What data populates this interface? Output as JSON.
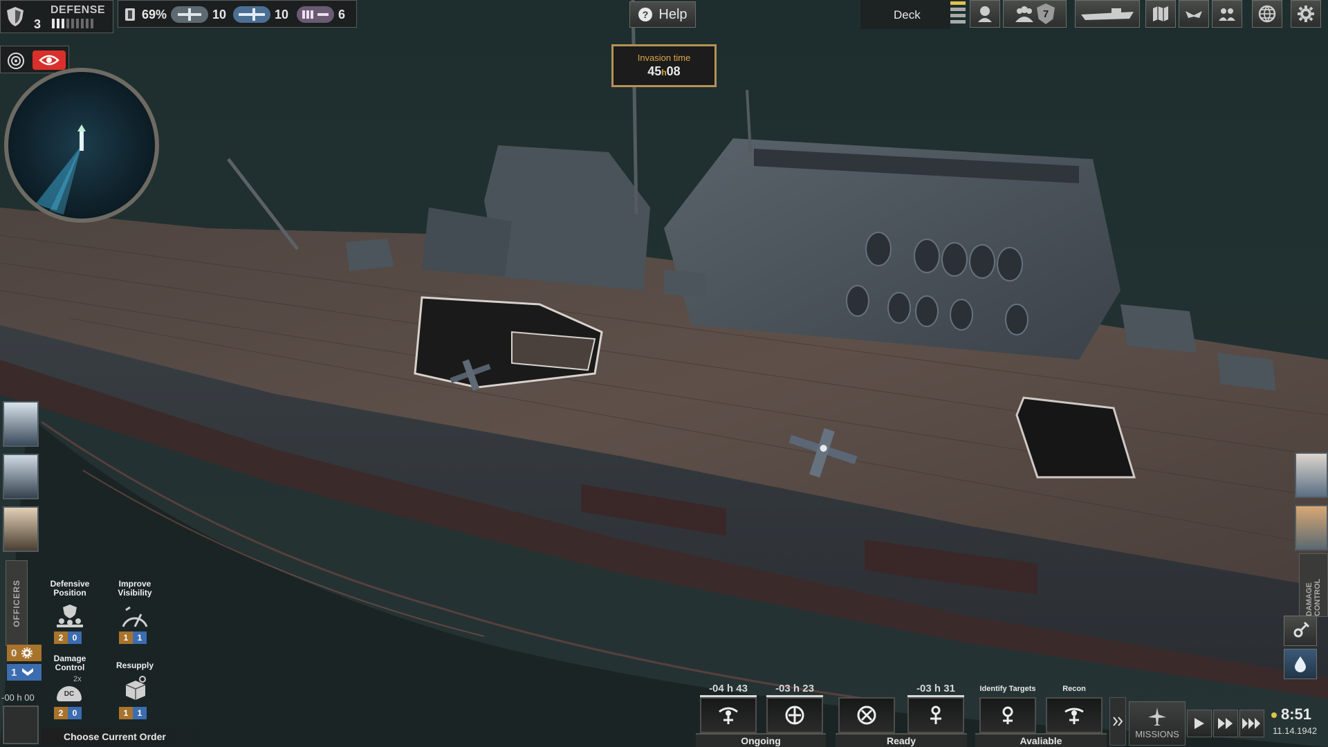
{
  "top_status": {
    "defense_level": "3",
    "defense_label": "DEFENSE",
    "hull_percent": "69%",
    "fighters_count": "10",
    "bombers_count": "10",
    "torpedo_count": "6"
  },
  "help": {
    "label": "Help"
  },
  "invasion": {
    "label": "Invasion time",
    "hours": "45",
    "h_sep": "h",
    "minutes": "08"
  },
  "view": {
    "label": "Deck"
  },
  "top_menu": {
    "crew_badge": "7"
  },
  "officers": {
    "tab_label": "OFFICERS"
  },
  "orders": {
    "items": [
      {
        "label": "Defensive Position",
        "orange": "2",
        "blue": "0"
      },
      {
        "label": "Improve Visibility",
        "orange": "1",
        "blue": "1"
      },
      {
        "label": "Damage Control",
        "multiplier": "2x",
        "icon_text": "DC",
        "orange": "2",
        "blue": "0"
      },
      {
        "label": "Resupply",
        "orange": "1",
        "blue": "1"
      }
    ],
    "available_orange": "0",
    "available_blue": "1",
    "timer": "-00 h 00",
    "footer": "Choose Current Order"
  },
  "damage_control_tab": {
    "label": "DAMAGE CONTROL"
  },
  "missions": {
    "slots": [
      {
        "time": "-04 h 43"
      },
      {
        "time": "-03 h 23"
      },
      {
        "time": ""
      },
      {
        "time": "-03 h 31"
      },
      {
        "caption": "Identify Targets"
      },
      {
        "caption": "Recon"
      }
    ],
    "groups": [
      "Ongoing",
      "Ready",
      "Avaliable"
    ],
    "button_label": "MISSIONS"
  },
  "clock": {
    "time": "8:51",
    "date": "11.14.1942"
  },
  "colors": {
    "accent_orange": "#e0a64a",
    "eye_red": "#d9302c",
    "order_blue": "#3c6db0"
  }
}
